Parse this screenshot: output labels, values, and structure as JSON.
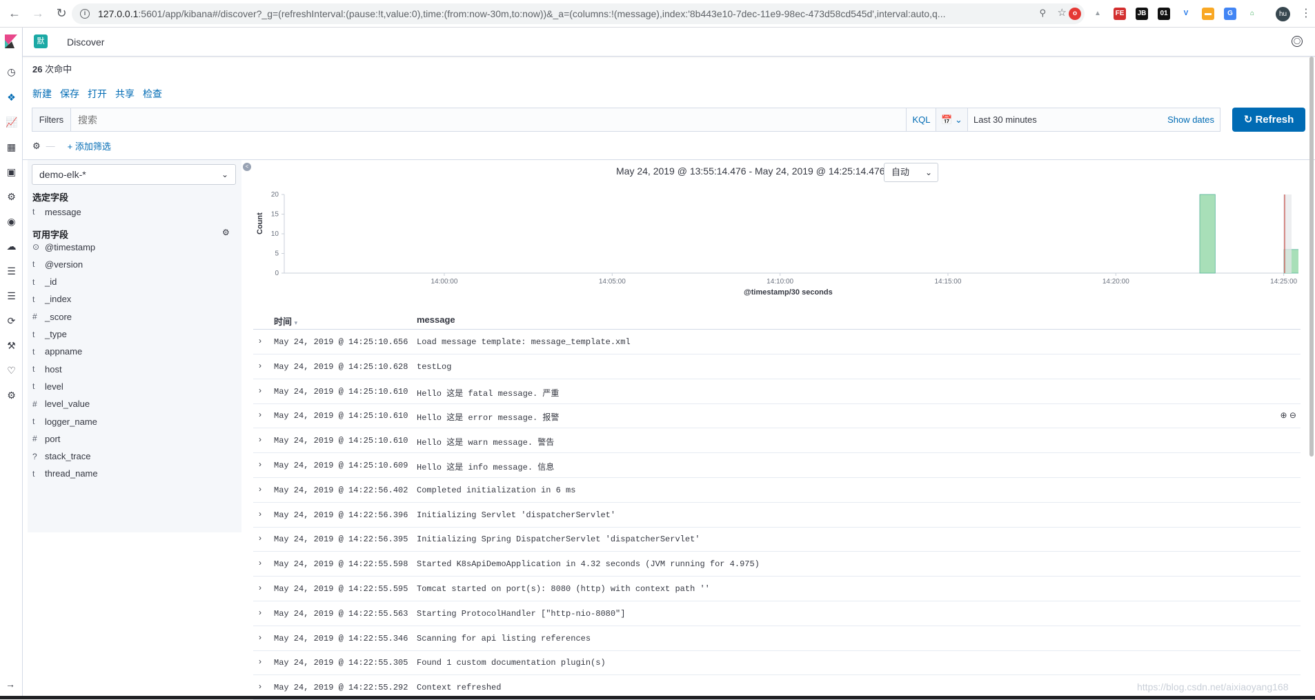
{
  "browser": {
    "url_host": "127.0.0.1",
    "url_rest": ":5601/app/kibana#/discover?_g=(refreshInterval:(pause:!t,value:0),time:(from:now-30m,to:now))&_a=(columns:!(message),index:'8b443e10-7dec-11e9-98ec-473d58cd545d',interval:auto,q...",
    "profile_initials": "hu"
  },
  "header": {
    "app_badge": "默",
    "title": "Discover"
  },
  "hits": {
    "count": "26",
    "label": "次命中"
  },
  "top_menu": [
    "新建",
    "保存",
    "打开",
    "共享",
    "检查"
  ],
  "query": {
    "filters_label": "Filters",
    "search_placeholder": "搜索",
    "kql_label": "KQL",
    "date_range": "Last 30 minutes",
    "show_dates": "Show dates",
    "refresh_label": "Refresh",
    "add_filter": "+ 添加筛选"
  },
  "sidebar": {
    "index_pattern": "demo-elk-*",
    "selected_heading": "选定字段",
    "selected_fields": [
      {
        "type": "t",
        "name": "message"
      }
    ],
    "available_heading": "可用字段",
    "available_fields": [
      {
        "type": "⊙",
        "name": "@timestamp"
      },
      {
        "type": "t",
        "name": "@version"
      },
      {
        "type": "t",
        "name": "_id"
      },
      {
        "type": "t",
        "name": "_index"
      },
      {
        "type": "#",
        "name": "_score"
      },
      {
        "type": "t",
        "name": "_type"
      },
      {
        "type": "t",
        "name": "appname"
      },
      {
        "type": "t",
        "name": "host"
      },
      {
        "type": "t",
        "name": "level"
      },
      {
        "type": "#",
        "name": "level_value"
      },
      {
        "type": "t",
        "name": "logger_name"
      },
      {
        "type": "#",
        "name": "port"
      },
      {
        "type": "?",
        "name": "stack_trace"
      },
      {
        "type": "t",
        "name": "thread_name"
      }
    ]
  },
  "histogram": {
    "range_label": "May 24, 2019 @ 13:55:14.476 - May 24, 2019 @ 14:25:14.476 —",
    "interval_value": "自动"
  },
  "chart_data": {
    "type": "bar",
    "xlabel": "@timestamp/30 seconds",
    "ylabel": "Count",
    "ylim": [
      0,
      20
    ],
    "yticks": [
      "0",
      "5",
      "10",
      "15",
      "20"
    ],
    "xticks": [
      "14:00:00",
      "14:05:00",
      "14:10:00",
      "14:15:00",
      "14:20:00",
      "14:25:00"
    ],
    "series": [
      {
        "values": [
          {
            "x": "14:22:30",
            "y": 20
          },
          {
            "x": "14:25:00",
            "y": 6
          }
        ]
      }
    ],
    "colors": {
      "bar": "#a8dfb8",
      "bar_stroke": "#54b399",
      "now_line": "#bd271e"
    }
  },
  "table": {
    "col_time": "时间",
    "col_message": "message",
    "rows": [
      {
        "time": "May 24, 2019 @ 14:25:10.656",
        "message": "Load message template: message_template.xml"
      },
      {
        "time": "May 24, 2019 @ 14:25:10.628",
        "message": "testLog"
      },
      {
        "time": "May 24, 2019 @ 14:25:10.610",
        "message": "Hello 这是 fatal message. 严重"
      },
      {
        "time": "May 24, 2019 @ 14:25:10.610",
        "message": "Hello 这是 error message. 报警"
      },
      {
        "time": "May 24, 2019 @ 14:25:10.610",
        "message": "Hello 这是 warn message. 警告"
      },
      {
        "time": "May 24, 2019 @ 14:25:10.609",
        "message": "Hello 这是 info message. 信息"
      },
      {
        "time": "May 24, 2019 @ 14:22:56.402",
        "message": "Completed initialization in 6 ms"
      },
      {
        "time": "May 24, 2019 @ 14:22:56.396",
        "message": "Initializing Servlet 'dispatcherServlet'"
      },
      {
        "time": "May 24, 2019 @ 14:22:56.395",
        "message": "Initializing Spring DispatcherServlet 'dispatcherServlet'"
      },
      {
        "time": "May 24, 2019 @ 14:22:55.598",
        "message": "Started K8sApiDemoApplication in 4.32 seconds (JVM running for 4.975)"
      },
      {
        "time": "May 24, 2019 @ 14:22:55.595",
        "message": "Tomcat started on port(s): 8080 (http) with context path ''"
      },
      {
        "time": "May 24, 2019 @ 14:22:55.563",
        "message": "Starting ProtocolHandler [\"http-nio-8080\"]"
      },
      {
        "time": "May 24, 2019 @ 14:22:55.346",
        "message": "Scanning for api listing references"
      },
      {
        "time": "May 24, 2019 @ 14:22:55.305",
        "message": "Found 1 custom documentation plugin(s)"
      },
      {
        "time": "May 24, 2019 @ 14:22:55.292",
        "message": "Context refreshed"
      }
    ]
  },
  "watermark": "https://blog.csdn.net/aixiaoyang168"
}
